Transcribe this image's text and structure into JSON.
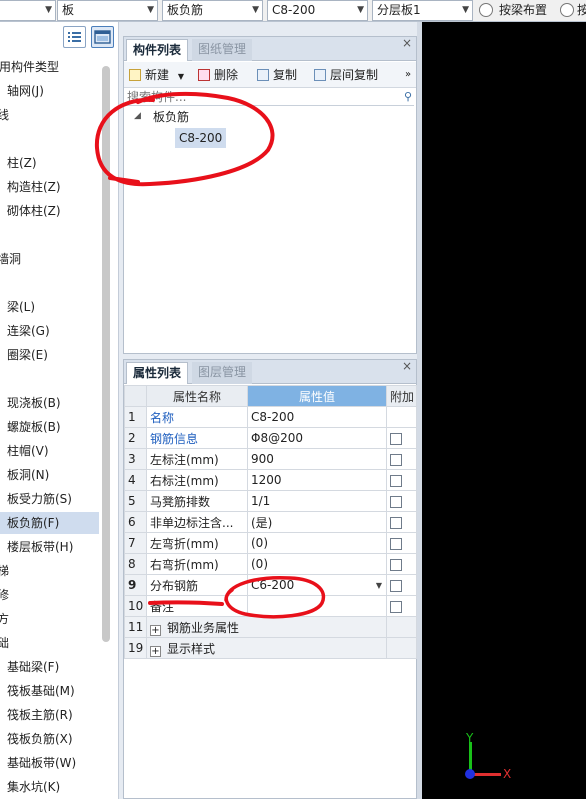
{
  "toolbar": {
    "combo1": "",
    "combo2": "板",
    "combo3": "板负筋",
    "combo4": "C8-200",
    "combo5": "分层板1",
    "radio1": "按梁布置",
    "radio2": "按"
  },
  "leftnav": {
    "items": [
      {
        "label": "用构件类型"
      },
      {
        "label": "轴网(J)"
      },
      {
        "label": "线"
      },
      {
        "label": "柱(Z)"
      },
      {
        "label": "构造柱(Z)"
      },
      {
        "label": "砌体柱(Z)"
      },
      {
        "label": "墙洞"
      },
      {
        "label": "梁(L)"
      },
      {
        "label": "连梁(G)"
      },
      {
        "label": "圈梁(E)"
      },
      {
        "label": "现浇板(B)"
      },
      {
        "label": "螺旋板(B)"
      },
      {
        "label": "柱帽(V)"
      },
      {
        "label": "板洞(N)"
      },
      {
        "label": "板受力筋(S)"
      },
      {
        "label": "板负筋(F)"
      },
      {
        "label": "楼层板带(H)"
      },
      {
        "label": "梯"
      },
      {
        "label": "修"
      },
      {
        "label": "方"
      },
      {
        "label": "础"
      },
      {
        "label": "基础梁(F)"
      },
      {
        "label": "筏板基础(M)"
      },
      {
        "label": "筏板主筋(R)"
      },
      {
        "label": "筏板负筋(X)"
      },
      {
        "label": "基础板带(W)"
      },
      {
        "label": "集水坑(K)"
      }
    ]
  },
  "component_panel": {
    "tab_active": "构件列表",
    "tab_inactive": "图纸管理",
    "buttons": {
      "new": "新建",
      "delete": "删除",
      "copy": "复制",
      "floor_copy": "层间复制"
    },
    "search_placeholder": "搜索构件...",
    "tree": {
      "root": "板负筋",
      "child": "C8-200"
    }
  },
  "property_panel": {
    "tab_active": "属性列表",
    "tab_inactive": "图层管理",
    "headers": {
      "name": "属性名称",
      "value": "属性值",
      "extra": "附加"
    },
    "rows": [
      {
        "n": "1",
        "name": "名称",
        "value": "C8-200"
      },
      {
        "n": "2",
        "name": "钢筋信息",
        "value": "Φ8@200"
      },
      {
        "n": "3",
        "name": "左标注(mm)",
        "value": "900"
      },
      {
        "n": "4",
        "name": "右标注(mm)",
        "value": "1200"
      },
      {
        "n": "5",
        "name": "马凳筋排数",
        "value": "1/1"
      },
      {
        "n": "6",
        "name": "非单边标注含...",
        "value": "(是)"
      },
      {
        "n": "7",
        "name": "左弯折(mm)",
        "value": "(0)"
      },
      {
        "n": "8",
        "name": "右弯折(mm)",
        "value": "(0)"
      },
      {
        "n": "9",
        "name": "分布钢筋",
        "value": "C6-200"
      },
      {
        "n": "10",
        "name": "备注",
        "value": ""
      },
      {
        "n": "11",
        "name": "钢筋业务属性",
        "value": ""
      },
      {
        "n": "19",
        "name": "显示样式",
        "value": ""
      }
    ]
  },
  "canvas": {
    "axis_y": "Y",
    "axis_x": "X"
  },
  "colors": {
    "annotation": "#e8101a",
    "selection": "#cfdcee",
    "value_header": "#7fb2e3"
  }
}
